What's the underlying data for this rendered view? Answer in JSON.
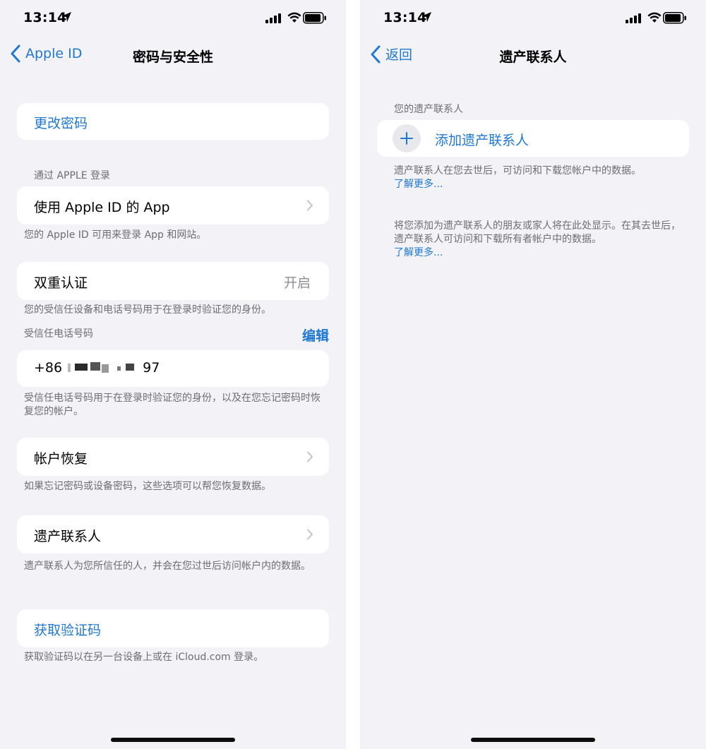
{
  "left": {
    "status": {
      "time": "13:14"
    },
    "nav": {
      "back_label": "Apple ID",
      "title": "密码与安全性"
    },
    "change_password": "更改密码",
    "sign_in_header": "通过 APPLE 登录",
    "apps_using_appleid": "使用 Apple ID 的 App",
    "apps_footnote": "您的 Apple ID 可用来登录 App 和网站。",
    "two_factor": {
      "label": "双重认证",
      "value": "开启"
    },
    "two_factor_footnote": "您的受信任设备和电话号码用于在登录时验证您的身份。",
    "trusted_phone_header": "受信任电话号码",
    "edit": "编辑",
    "phone_prefix": "+86",
    "phone_suffix": "97",
    "phone_footnote": "受信任电话号码用于在登录时验证您的身份，以及在您忘记密码时恢复您的帐户。",
    "account_recovery": "帐户恢复",
    "recovery_footnote": "如果忘记密码或设备密码，这些选项可以帮您恢复数据。",
    "legacy_contact": "遗产联系人",
    "legacy_footnote": "遗产联系人为您所信任的人，并会在您过世后访问帐户内的数据。",
    "get_code": "获取验证码",
    "get_code_footnote": "获取验证码以在另一台设备上或在 iCloud.com 登录。"
  },
  "right": {
    "status": {
      "time": "13:14"
    },
    "nav": {
      "back_label": "返回",
      "title": "遗产联系人"
    },
    "section_header": "您的遗产联系人",
    "add_label": "添加遗产联系人",
    "note1": "遗产联系人在您去世后，可访问和下载您帐户中的数据。",
    "learn_more_1": "了解更多...",
    "note2": "将您添加为遗产联系人的朋友或家人将在此处显示。在其去世后，遗产联系人可访问和下载所有者帐户中的数据。",
    "learn_more_2": "了解更多..."
  },
  "colors": {
    "accent": "#1f78d1",
    "background": "#f2f2f7",
    "secondary_text": "#6d6d72"
  },
  "icons": [
    "location-arrow-icon",
    "cellular-signal-icon",
    "wifi-icon",
    "battery-icon",
    "chevron-left-icon",
    "chevron-right-icon",
    "plus-icon"
  ]
}
